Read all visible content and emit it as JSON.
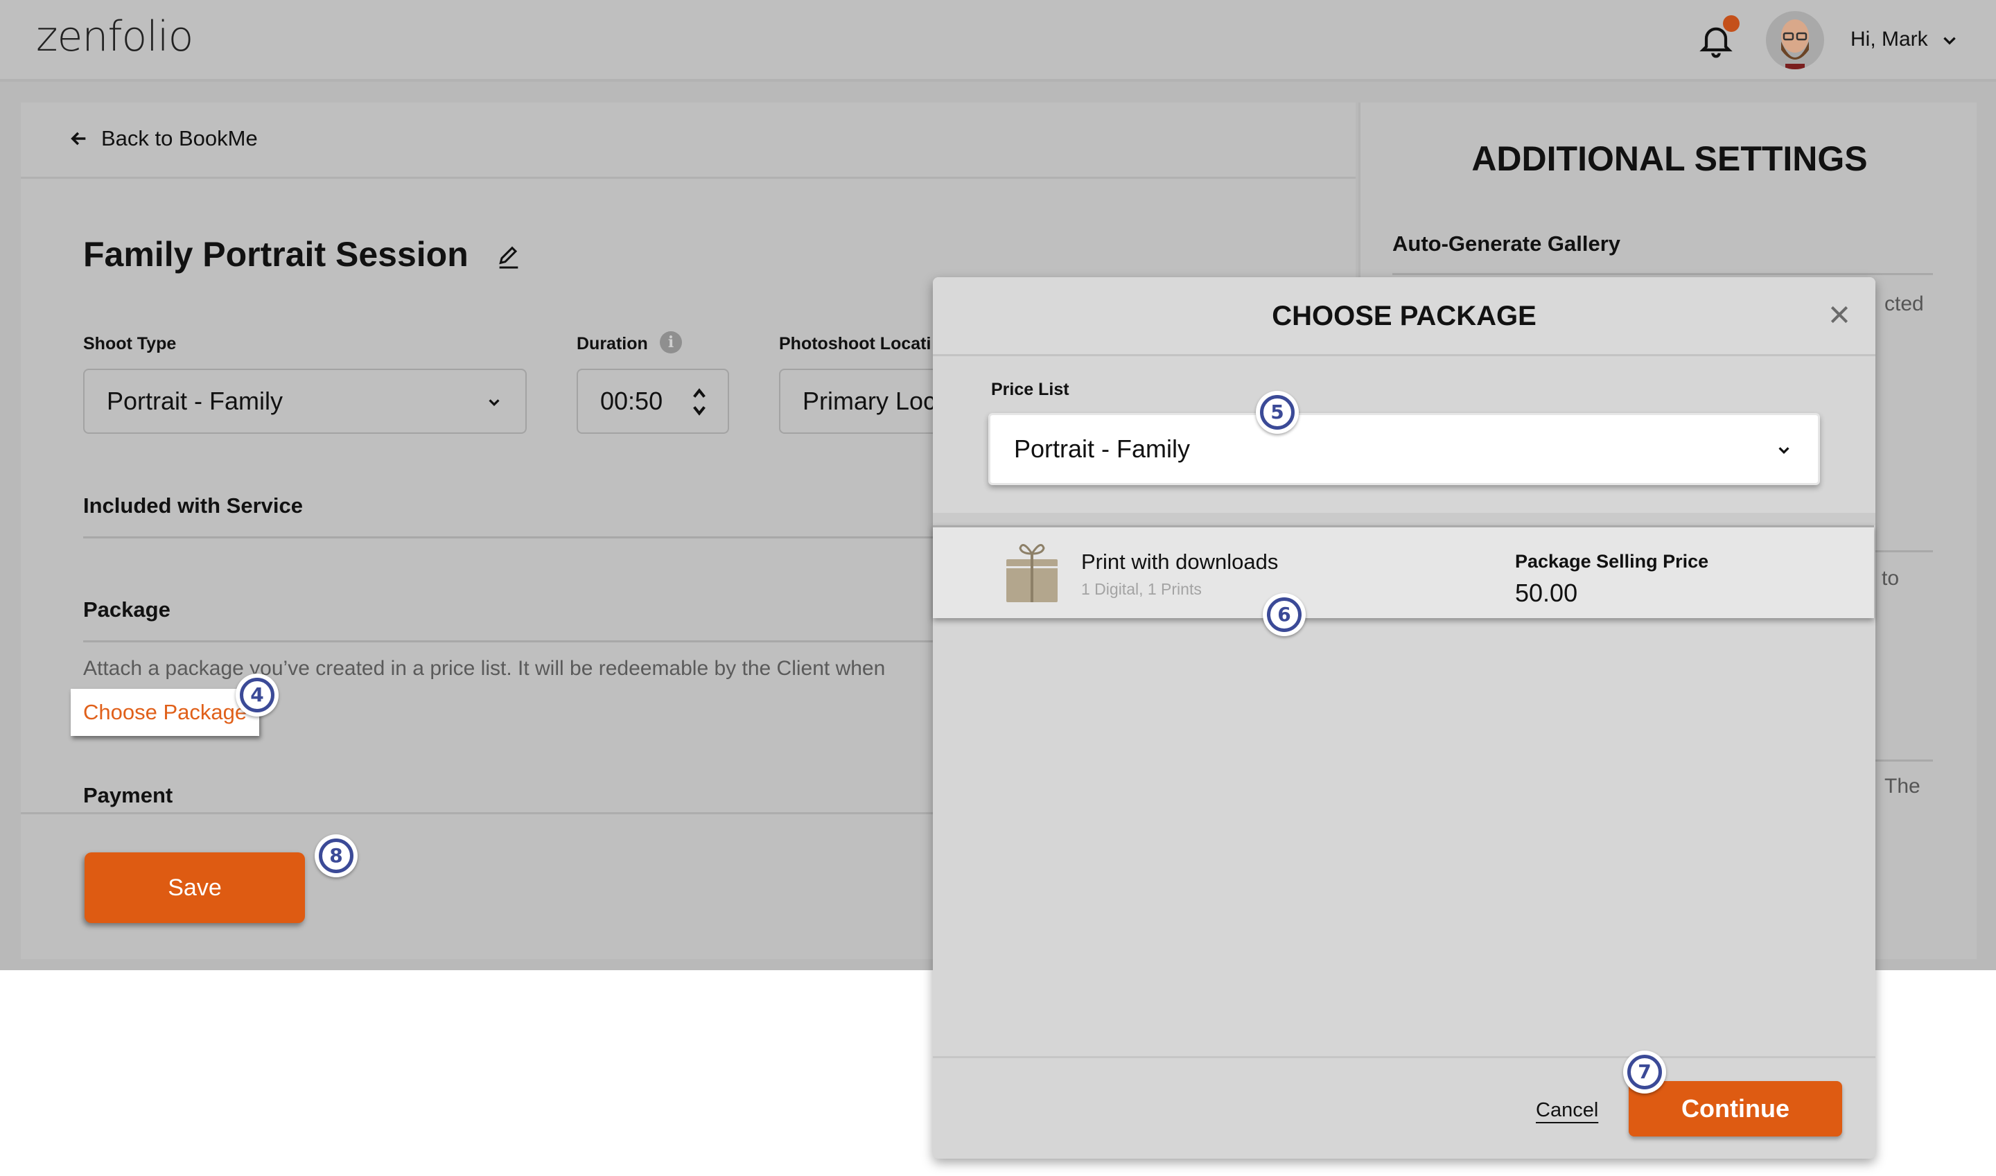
{
  "header": {
    "logo": "zenfolio",
    "user_greeting": "Hi, Mark",
    "notification_badge_color": "#c4501a"
  },
  "main": {
    "back_link": "Back to BookMe",
    "title": "Family Portrait Session",
    "fields": {
      "shoot_type": {
        "label": "Shoot Type",
        "value": "Portrait - Family"
      },
      "duration": {
        "label": "Duration",
        "value": "00:50",
        "info_icon": "i"
      },
      "location": {
        "label": "Photoshoot Locati",
        "value": "Primary Loc"
      }
    },
    "sections": {
      "included": "Included with Service",
      "package": "Package",
      "package_desc": "Attach a package you’ve created in a price list. It will be redeemable by the Client when",
      "choose_package": "Choose Package",
      "payment": "Payment"
    },
    "save_label": "Save"
  },
  "side_panel": {
    "title": "ADDITIONAL SETTINGS",
    "item_title": "Auto-Generate Gallery",
    "fragments": [
      "cted",
      "to",
      "The"
    ]
  },
  "modal": {
    "title": "CHOOSE PACKAGE",
    "price_list_label": "Price List",
    "price_list_value": "Portrait - Family",
    "package": {
      "name": "Print with downloads",
      "details": "1 Digital, 1 Prints",
      "price_label": "Package Selling Price",
      "price": "50.00"
    },
    "cancel_label": "Cancel",
    "continue_label": "Continue"
  },
  "step_markers": [
    "4",
    "5",
    "6",
    "7",
    "8"
  ],
  "colors": {
    "accent": "#de5b12",
    "marker": "#3b4a97",
    "link": "#e0601a"
  }
}
